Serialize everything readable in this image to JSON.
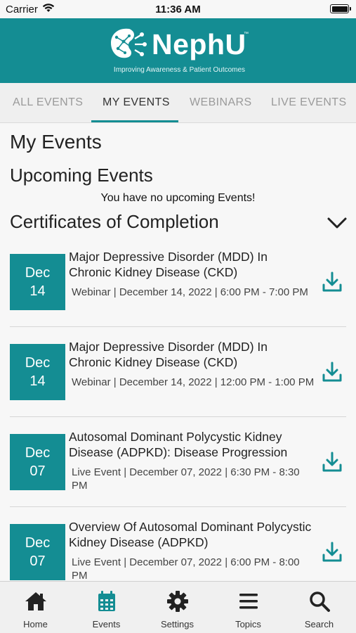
{
  "status_bar": {
    "carrier": "Carrier",
    "time": "11:36 AM"
  },
  "brand": {
    "name": "NephU",
    "trademark": "™",
    "tagline": "Improving Awareness & Patient Outcomes"
  },
  "tabs": [
    {
      "label": "ALL EVENTS",
      "active": false
    },
    {
      "label": "MY EVENTS",
      "active": true
    },
    {
      "label": "WEBINARS",
      "active": false
    },
    {
      "label": "LIVE EVENTS",
      "active": false
    }
  ],
  "page": {
    "title": "My Events",
    "upcoming_title": "Upcoming Events",
    "upcoming_empty": "You have no upcoming Events!",
    "certificates_title": "Certificates of Completion"
  },
  "certificates": [
    {
      "month": "Dec",
      "day": "14",
      "title": "Major Depressive Disorder (MDD) In Chronic Kidney Disease (CKD)",
      "meta": "Webinar | December 14, 2022 | 6:00 PM - 7:00 PM"
    },
    {
      "month": "Dec",
      "day": "14",
      "title": "Major Depressive Disorder (MDD) In Chronic Kidney Disease (CKD)",
      "meta": "Webinar | December 14, 2022 | 12:00 PM - 1:00 PM"
    },
    {
      "month": "Dec",
      "day": "07",
      "title": "Autosomal Dominant Polycystic Kidney Disease (ADPKD): Disease Progression",
      "meta": "Live Event | December 07, 2022 | 6:30 PM - 8:30 PM"
    },
    {
      "month": "Dec",
      "day": "07",
      "title": "Overview Of Autosomal Dominant Polycystic Kidney Disease (ADPKD)",
      "meta": "Live Event | December 07, 2022 | 6:00 PM - 8:00 PM"
    }
  ],
  "bottom_nav": [
    {
      "label": "Home",
      "icon": "home-icon",
      "active": false
    },
    {
      "label": "Events",
      "icon": "calendar-icon",
      "active": true
    },
    {
      "label": "Settings",
      "icon": "gear-icon",
      "active": false
    },
    {
      "label": "Topics",
      "icon": "menu-icon",
      "active": false
    },
    {
      "label": "Search",
      "icon": "search-icon",
      "active": false
    }
  ],
  "colors": {
    "brand_teal": "#148d93",
    "nav_active": "#148d93",
    "nav_inactive": "#222222"
  }
}
